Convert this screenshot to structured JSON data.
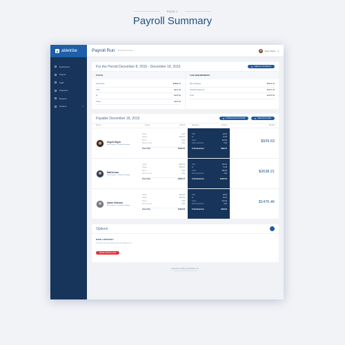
{
  "page": {
    "label": "PAGE 1",
    "title": "Payroll Summary"
  },
  "brand": {
    "name": "abletribe"
  },
  "sidebar": {
    "items": [
      {
        "label": "Dashboard",
        "icon": "dashboard-icon"
      },
      {
        "label": "Payroll",
        "icon": "dollar-icon"
      },
      {
        "label": "Staff",
        "icon": "staff-icon"
      },
      {
        "label": "Paystubs",
        "icon": "paystub-icon"
      },
      {
        "label": "Reports",
        "icon": "reports-icon"
      },
      {
        "label": "Options",
        "icon": "gear-icon",
        "has_caret": true
      }
    ]
  },
  "topbar": {
    "title": "Payroll Run",
    "subtitle": "Bi-Weekly Schedule",
    "user_name": "Ryan Robin"
  },
  "period_card": {
    "title": "For the Peroid December 8, 2015  - December 18, 2015",
    "button": "VIEW ALL PAYROLLS",
    "totals": {
      "heading": "TOTALS",
      "rows": [
        {
          "label": "Gross Pay",
          "value": "$6889.23"
        },
        {
          "label": "CPP",
          "value": "$321.00"
        },
        {
          "label": "EI",
          "value": "$129.52"
        },
        {
          "label": "Taxes",
          "value": "$129.52"
        }
      ]
    },
    "cash": {
      "heading": "CASH REQUIREMENTS",
      "rows": [
        {
          "label": "Pay Cheques",
          "value": "$5044.30"
        },
        {
          "label": "CRA Remittances",
          "value": "$2347.29"
        },
        {
          "label": "Total",
          "value": "$7391.59"
        }
      ]
    }
  },
  "payable_card": {
    "title": "Payable December 18, 2015",
    "buttons": {
      "download": "DOWNLOAD PAYSTUBS",
      "view": "VIEW PAYSTUBS"
    },
    "headers": {
      "person": "Person",
      "income": "Income",
      "amount": "Amount",
      "deduction": "Deduction",
      "damount": "Amount",
      "net": "Net Pay"
    },
    "income_labels": [
      "Salary",
      "Wages",
      "Bonus",
      "Other Income"
    ],
    "gross_label": "Gross Pay",
    "deduction_labels": [
      "CPP",
      "EI",
      "Taxes",
      "Other Deduction"
    ],
    "total_ded_label": "Total Deduction",
    "rows": [
      {
        "name": "Angeli Hayes",
        "sub": "Hire Payment • Unrelated Payslips",
        "income": [
          "0.00",
          "1920.00",
          "0.00",
          "0.00"
        ],
        "gross": "$1920.00",
        "deductions": [
          "46.78",
          "21.06",
          "120.53",
          "0.00"
        ],
        "total_deduction": "$990.37",
        "net": "$929.63"
      },
      {
        "name": "Matt brown",
        "sub": "Hire Payment • Unrelated Payslips",
        "income": [
          "3846.15",
          "1920.00",
          "0.00",
          "0.00"
        ],
        "gross": "$3846.15",
        "deductions": [
          "163.72",
          "72.38",
          "950.29",
          "0.00"
        ],
        "total_deduction": "$1207.94",
        "net": "$2638.21"
      },
      {
        "name": "Adam Jhonson",
        "sub": "Hire Payment • Unrelated Payslips",
        "income": [
          "1923.08",
          "1920.00",
          "0.00",
          "0.00"
        ],
        "gross": "$1923.08",
        "deductions": [
          "48.53",
          "36.15",
          "321.94",
          "0.00"
        ],
        "total_deduction": "$446.62",
        "net": "$1476.46"
      }
    ]
  },
  "options_card": {
    "title": "Options",
    "mistake_title": "MADE A MISTAKE?",
    "mistake_sub": "It's okay. You can always reset your Payroll run",
    "reset_button": "RESET PAYROLL RUN"
  },
  "footer": {
    "line1": "powered by coffee and Abletribe Inc.",
    "line2": "Contains privacy info. Securely store"
  }
}
